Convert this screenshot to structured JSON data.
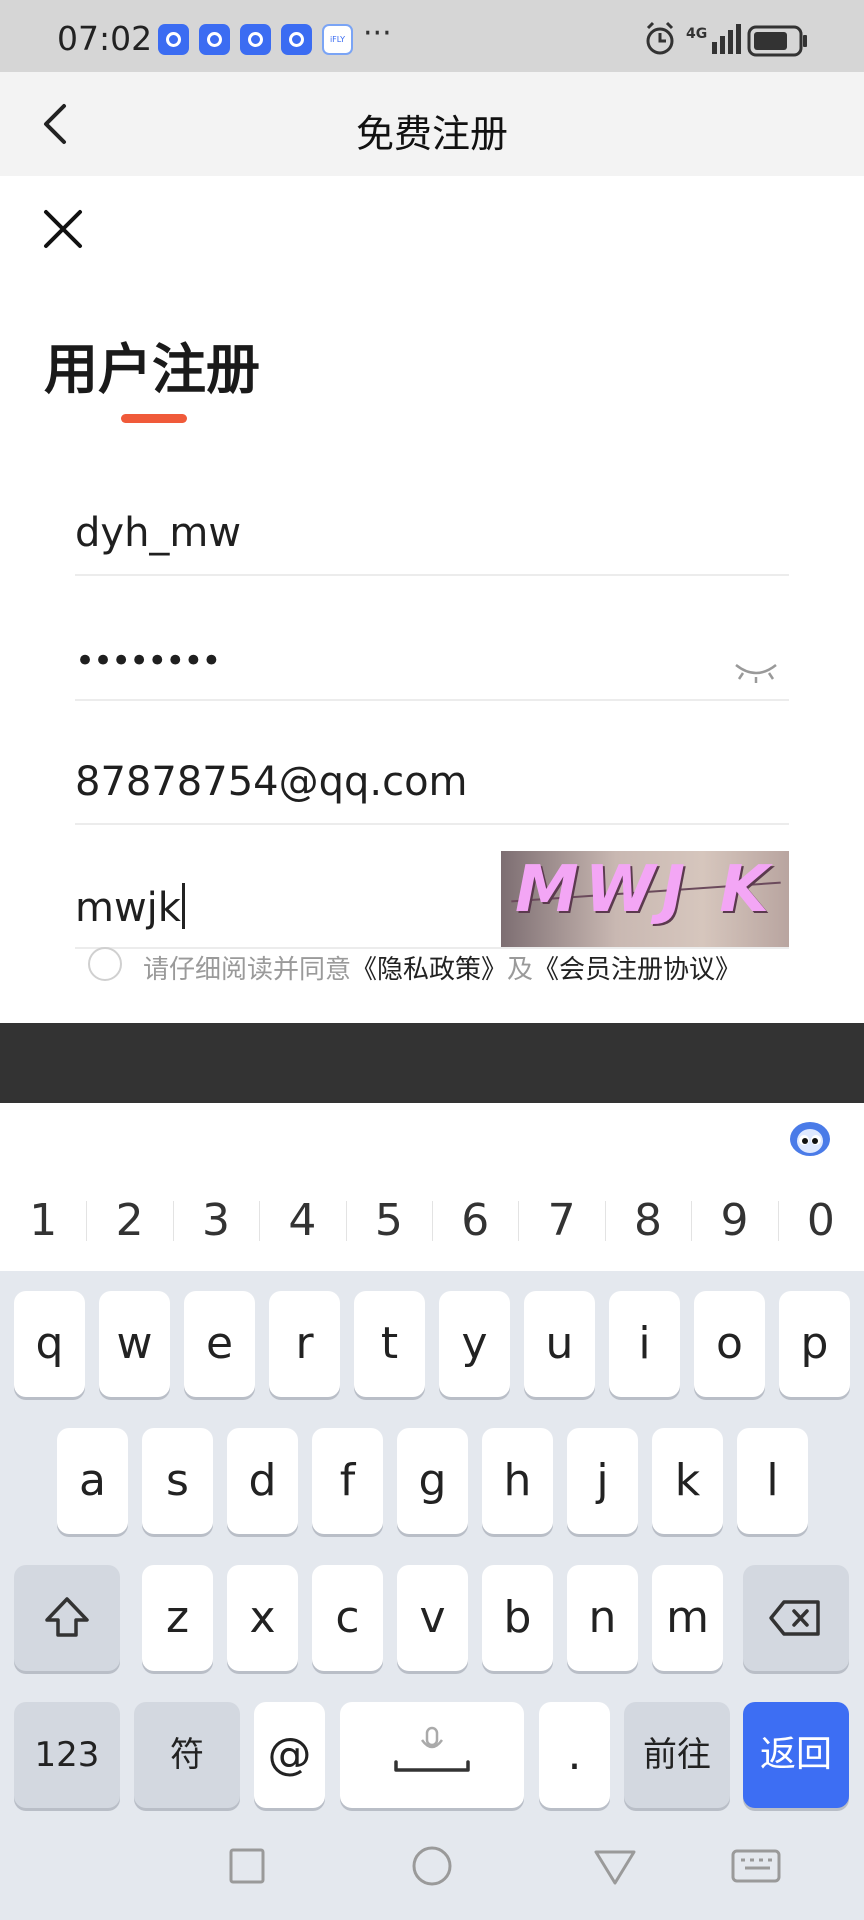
{
  "status_bar": {
    "time": "07:02",
    "app_icons": [
      "app-icon",
      "app-icon",
      "app-icon",
      "app-icon"
    ],
    "ifly_label": "iFLY",
    "more": "···",
    "network": "4G"
  },
  "header": {
    "title": "免费注册"
  },
  "form": {
    "heading": "用户注册",
    "username": "dyh_mw",
    "password_masked": "••••••••",
    "email": "87878754@qq.com",
    "captcha_input": "mwjk",
    "captcha_image_text": "MWJ K"
  },
  "agreement": {
    "prefix": "请仔细阅读并同意",
    "privacy_link": "《隐私政策》",
    "and": "及",
    "member_link": "《会员注册协议》"
  },
  "keyboard": {
    "numbers": [
      "1",
      "2",
      "3",
      "4",
      "5",
      "6",
      "7",
      "8",
      "9",
      "0"
    ],
    "row1": [
      "q",
      "w",
      "e",
      "r",
      "t",
      "y",
      "u",
      "i",
      "o",
      "p"
    ],
    "row2": [
      "a",
      "s",
      "d",
      "f",
      "g",
      "h",
      "j",
      "k",
      "l"
    ],
    "row3": [
      "z",
      "x",
      "c",
      "v",
      "b",
      "n",
      "m"
    ],
    "key_123": "123",
    "key_symbol": "符",
    "key_at": "@",
    "key_dot": ".",
    "key_go": "前往",
    "key_return": "返回"
  },
  "colors": {
    "accent": "#f05a3a",
    "key_blue": "#3d6ef3",
    "dark_bar": "#333333"
  }
}
